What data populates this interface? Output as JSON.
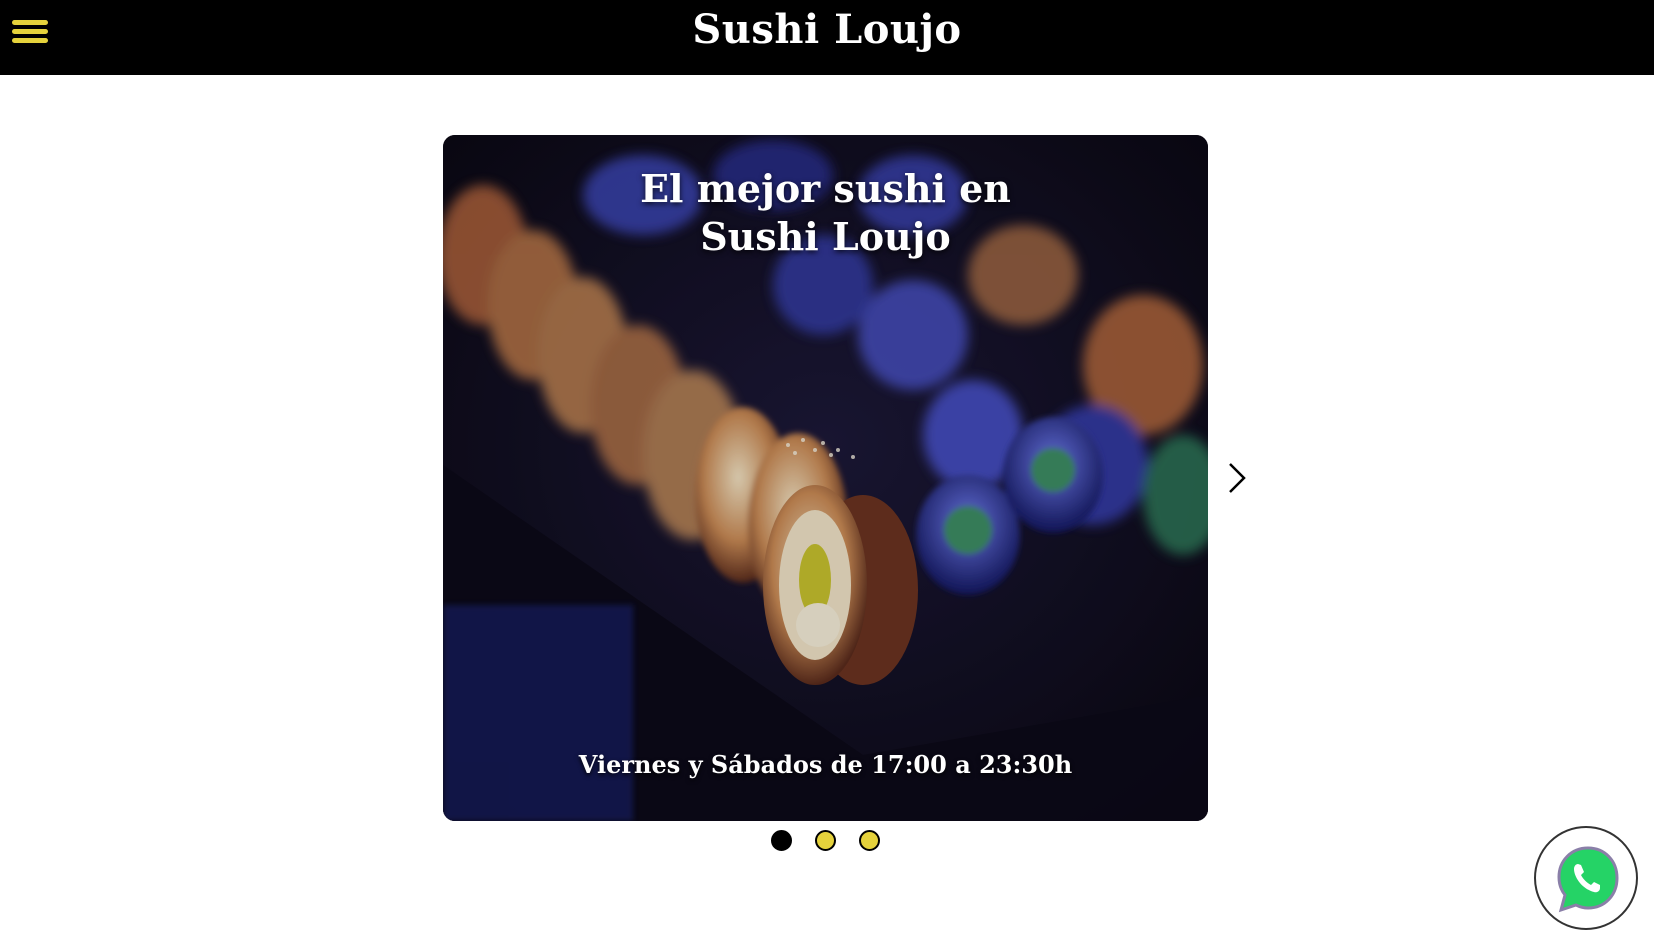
{
  "header": {
    "title": "Sushi Loujo",
    "menu_icon": "hamburger-menu-icon"
  },
  "hero_slider": {
    "heading_line1": "El mejor sushi en",
    "heading_line2": "Sushi Loujo",
    "hours": "Viernes y Sábados de 17:00 a 23:30h",
    "next_icon": "chevron-right-icon",
    "slide_count": 3,
    "active_slide": 1
  },
  "whatsapp": {
    "icon": "whatsapp-icon"
  },
  "colors": {
    "accent": "#e5d23c",
    "header_bg": "#000000",
    "whatsapp_green": "#25d366"
  }
}
